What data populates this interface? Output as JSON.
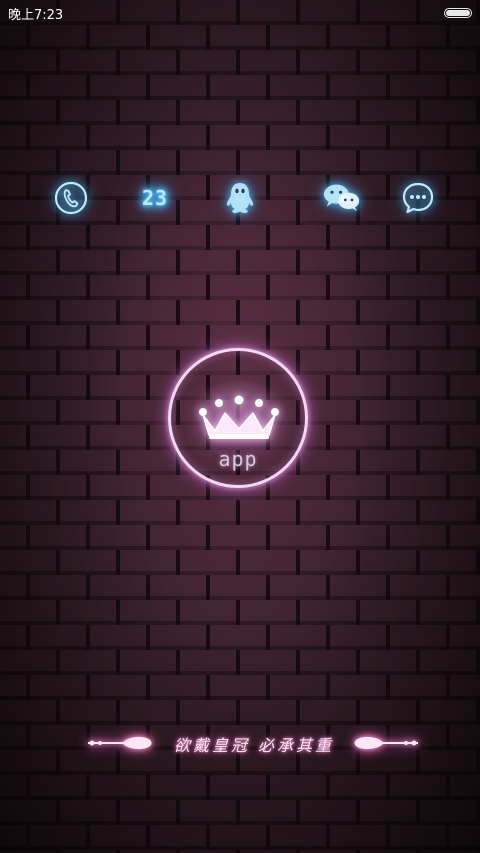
{
  "status_bar": {
    "time": "晚上7:23",
    "battery_icon": "battery-icon"
  },
  "dock": {
    "icons": [
      {
        "name": "phone-icon",
        "color": "#5ad0ff"
      },
      {
        "name": "calendar-icon",
        "label": "23",
        "color": "#5ad0ff"
      },
      {
        "name": "qq-penguin-icon",
        "color": "#5ad0ff"
      },
      {
        "name": "wechat-icon",
        "color": "#5ad0ff"
      },
      {
        "name": "messages-icon",
        "color": "#5ad0ff"
      }
    ]
  },
  "center_button": {
    "icon": "crown-icon",
    "label": "app",
    "ring_color": "#f1d9ef",
    "glow_color": "#c77ac7"
  },
  "slogan": {
    "text": "欲戴皇冠 必承其重",
    "color": "#fde7f5",
    "glow_color": "#e060b0"
  },
  "theme": {
    "wall_color": "#3a222c",
    "mortar_color": "#1f1218"
  }
}
